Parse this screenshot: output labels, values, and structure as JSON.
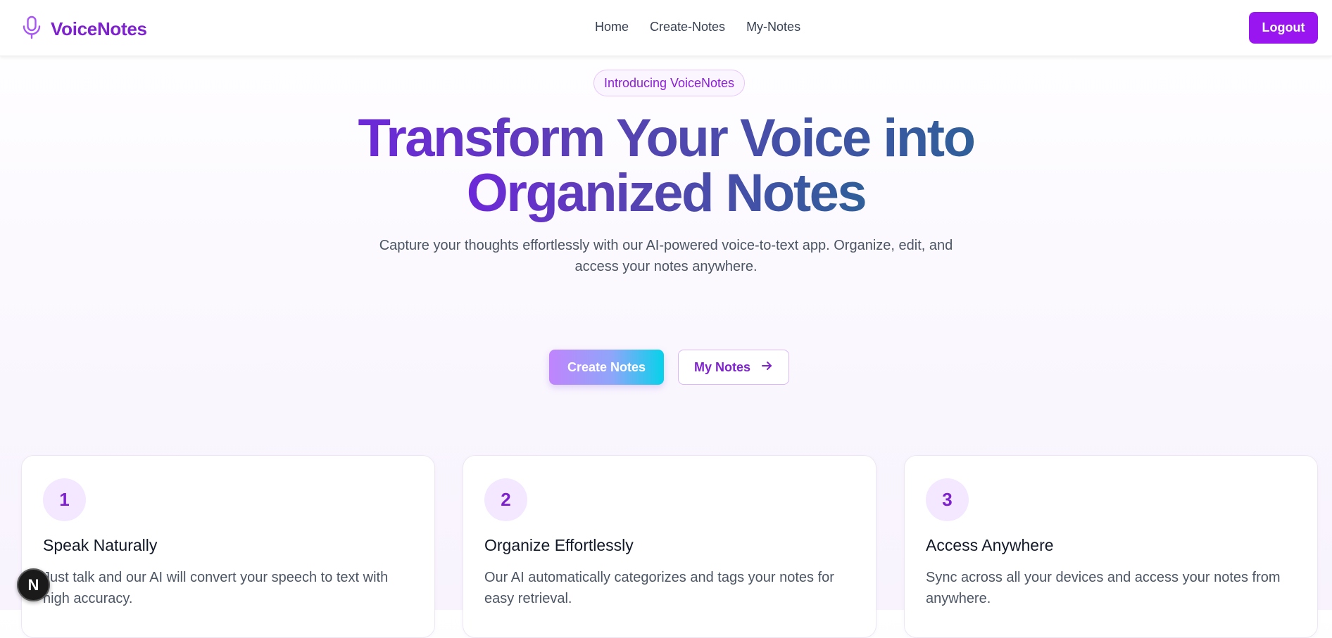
{
  "nav": {
    "brand": "VoiceNotes",
    "links": [
      "Home",
      "Create-Notes",
      "My-Notes"
    ],
    "logout_label": "Logout"
  },
  "hero": {
    "badge": "Introducing VoiceNotes",
    "headline_line1": "Transform Your Voice into",
    "headline_line2": "Organized Notes",
    "subtitle": "Capture your thoughts effortlessly with our AI-powered voice-to-text app. Organize, edit, and access your notes anywhere.",
    "primary_button": "Create Notes",
    "secondary_button": "My Notes"
  },
  "features": [
    {
      "number": "1",
      "title": "Speak Naturally",
      "description": "Just talk and our AI will convert your speech to text with high accuracy."
    },
    {
      "number": "2",
      "title": "Organize Effortlessly",
      "description": "Our AI automatically categorizes and tags your notes for easy retrieval."
    },
    {
      "number": "3",
      "title": "Access Anywhere",
      "description": "Sync across all your devices and access your notes from anywhere."
    }
  ],
  "dev_indicator": "N",
  "colors": {
    "brand": "#7e22ce",
    "logout_bg": "#9a16f0",
    "number_bg": "#f3e8ff"
  },
  "icons": {
    "brand": "microphone-icon",
    "my_notes_arrow": "arrow-right-icon"
  }
}
